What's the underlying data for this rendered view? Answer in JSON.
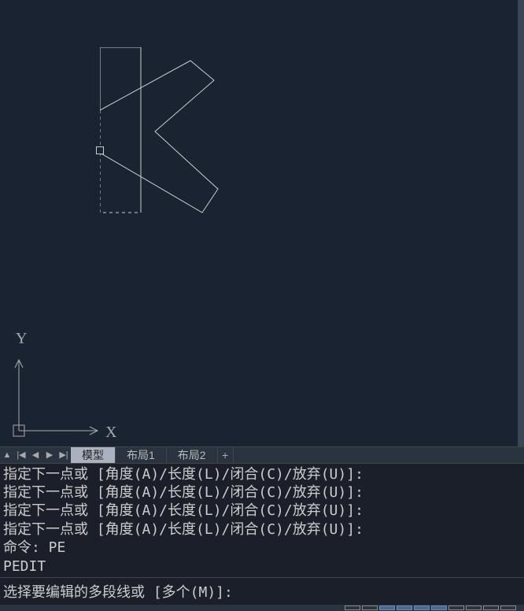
{
  "canvas": {
    "axes": {
      "x_label": "X",
      "y_label": "Y"
    }
  },
  "tabs": {
    "items": [
      {
        "label": "模型",
        "active": true
      },
      {
        "label": "布局1",
        "active": false
      },
      {
        "label": "布局2",
        "active": false
      }
    ],
    "add_label": "+"
  },
  "nav": {
    "up": "▲",
    "first": "|◀",
    "prev": "◀",
    "next": "▶",
    "last": "▶|"
  },
  "command_history": [
    "指定下一点或 [角度(A)/长度(L)/闭合(C)/放弃(U)]:",
    "指定下一点或 [角度(A)/长度(L)/闭合(C)/放弃(U)]:",
    "指定下一点或 [角度(A)/长度(L)/闭合(C)/放弃(U)]:",
    "指定下一点或 [角度(A)/长度(L)/闭合(C)/放弃(U)]:",
    "命令: PE",
    "PEDIT"
  ],
  "command_prompt": "选择要编辑的多段线或 [多个(M)]:"
}
